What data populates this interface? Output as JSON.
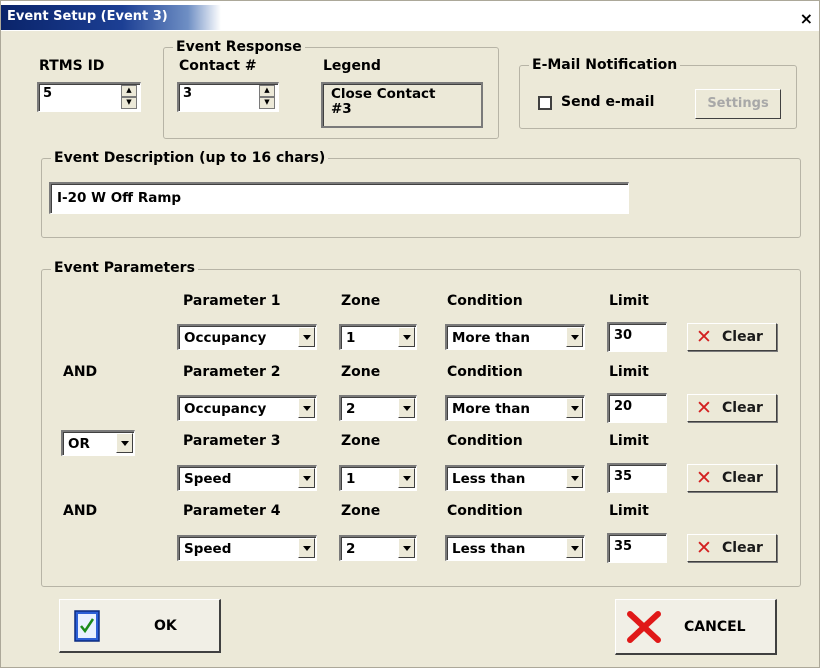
{
  "window": {
    "title": "Event Setup (Event 3)",
    "close_glyph": "×"
  },
  "rtms": {
    "label": "RTMS ID",
    "value": "5"
  },
  "event_response": {
    "group_label": "Event Response",
    "contact_label": "Contact #",
    "contact_value": "3",
    "legend_label": "Legend",
    "legend_line1": "Close Contact",
    "legend_line2": "#3"
  },
  "email": {
    "group_label": "E-Mail Notification",
    "send_label": "Send e-mail",
    "send_checked": false,
    "settings_label": "Settings"
  },
  "description": {
    "group_label": "Event Description (up to 16 chars)",
    "value": "I-20 W Off Ramp"
  },
  "parameters": {
    "group_label": "Event Parameters",
    "zone_header": "Zone",
    "condition_header": "Condition",
    "limit_header": "Limit",
    "clear_label": "Clear",
    "rows": [
      {
        "header": "Parameter 1",
        "param": "Occupancy",
        "zone": "1",
        "condition": "More than",
        "limit": "30"
      },
      {
        "header": "Parameter 2",
        "param": "Occupancy",
        "zone": "2",
        "condition": "More than",
        "limit": "20"
      },
      {
        "header": "Parameter 3",
        "param": "Speed",
        "zone": "1",
        "condition": "Less than",
        "limit": "35"
      },
      {
        "header": "Parameter 4",
        "param": "Speed",
        "zone": "2",
        "condition": "Less than",
        "limit": "35"
      }
    ],
    "logic_1": "AND",
    "logic_2": "OR",
    "logic_3": "AND"
  },
  "buttons": {
    "ok_label": "OK",
    "cancel_label": "CANCEL"
  },
  "colors": {
    "title_bar": "#0a246a",
    "dialog_bg": "#ece9d8",
    "clear_icon": "#d32020",
    "cancel_icon": "#e01818"
  }
}
